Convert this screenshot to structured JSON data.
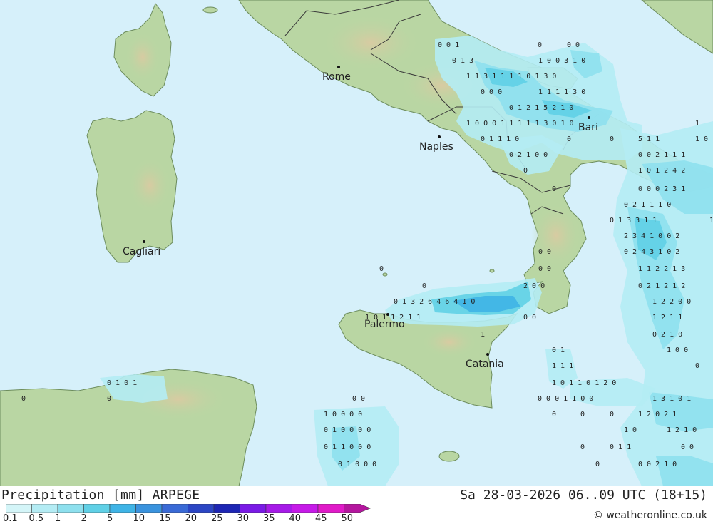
{
  "header": {
    "title": "Precipitation [mm] ARPEGE",
    "datetime": "Sa 28-03-2026 06..09 UTC (18+15)",
    "credit": "© weatheronline.co.uk"
  },
  "legend": {
    "labels": [
      "0.1",
      "0.5",
      "1",
      "2",
      "5",
      "10",
      "15",
      "20",
      "25",
      "30",
      "35",
      "40",
      "45",
      "50"
    ],
    "colors": [
      "#d4f5f8",
      "#b4ecf4",
      "#8ee0ee",
      "#60d0e6",
      "#3fb4e6",
      "#3a93de",
      "#3a6ad6",
      "#2c46c4",
      "#1e26b4",
      "#7a1ae6",
      "#a61ae8",
      "#c61ae8",
      "#e01ac8",
      "#b4169e"
    ]
  },
  "map": {
    "sea_color": "#d6f0fa",
    "land_color": "#b9d6a3",
    "cities": [
      {
        "name": "Rome",
        "label": "Rome"
      },
      {
        "name": "Naples",
        "label": "Naples"
      },
      {
        "name": "Bari",
        "label": "Bari"
      },
      {
        "name": "Cagliari",
        "label": "Cagliari"
      },
      {
        "name": "Palermo",
        "label": "Palermo"
      },
      {
        "name": "Catania",
        "label": "Catania"
      }
    ]
  }
}
